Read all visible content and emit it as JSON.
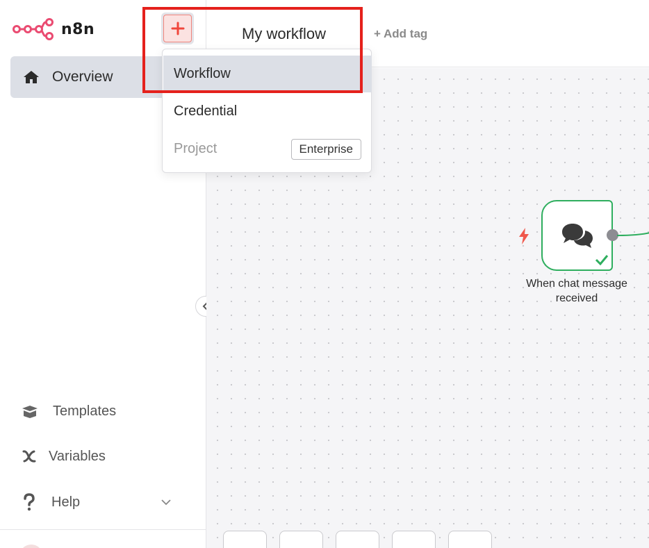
{
  "app": {
    "name": "n8n",
    "brand_color": "#ea4b71"
  },
  "sidebar": {
    "overview_label": "Overview",
    "templates_label": "Templates",
    "variables_label": "Variables",
    "help_label": "Help"
  },
  "header": {
    "workflow_title": "My workflow",
    "add_tag_label": "+ Add tag"
  },
  "create_menu": {
    "items": [
      {
        "label": "Workflow",
        "state": "highlighted"
      },
      {
        "label": "Credential",
        "state": "normal"
      },
      {
        "label": "Project",
        "state": "disabled",
        "badge": "Enterprise"
      }
    ]
  },
  "canvas": {
    "node": {
      "label_line1": "When chat message",
      "label_line2": "received",
      "status": "success",
      "icon": "chat-bubbles-icon",
      "border_color": "#2eae5e"
    },
    "trigger_icon": "lightning-icon"
  },
  "colors": {
    "highlight_box": "#e5211c",
    "plus_accent": "#f0473c",
    "active_bg": "#dcdfe6"
  }
}
